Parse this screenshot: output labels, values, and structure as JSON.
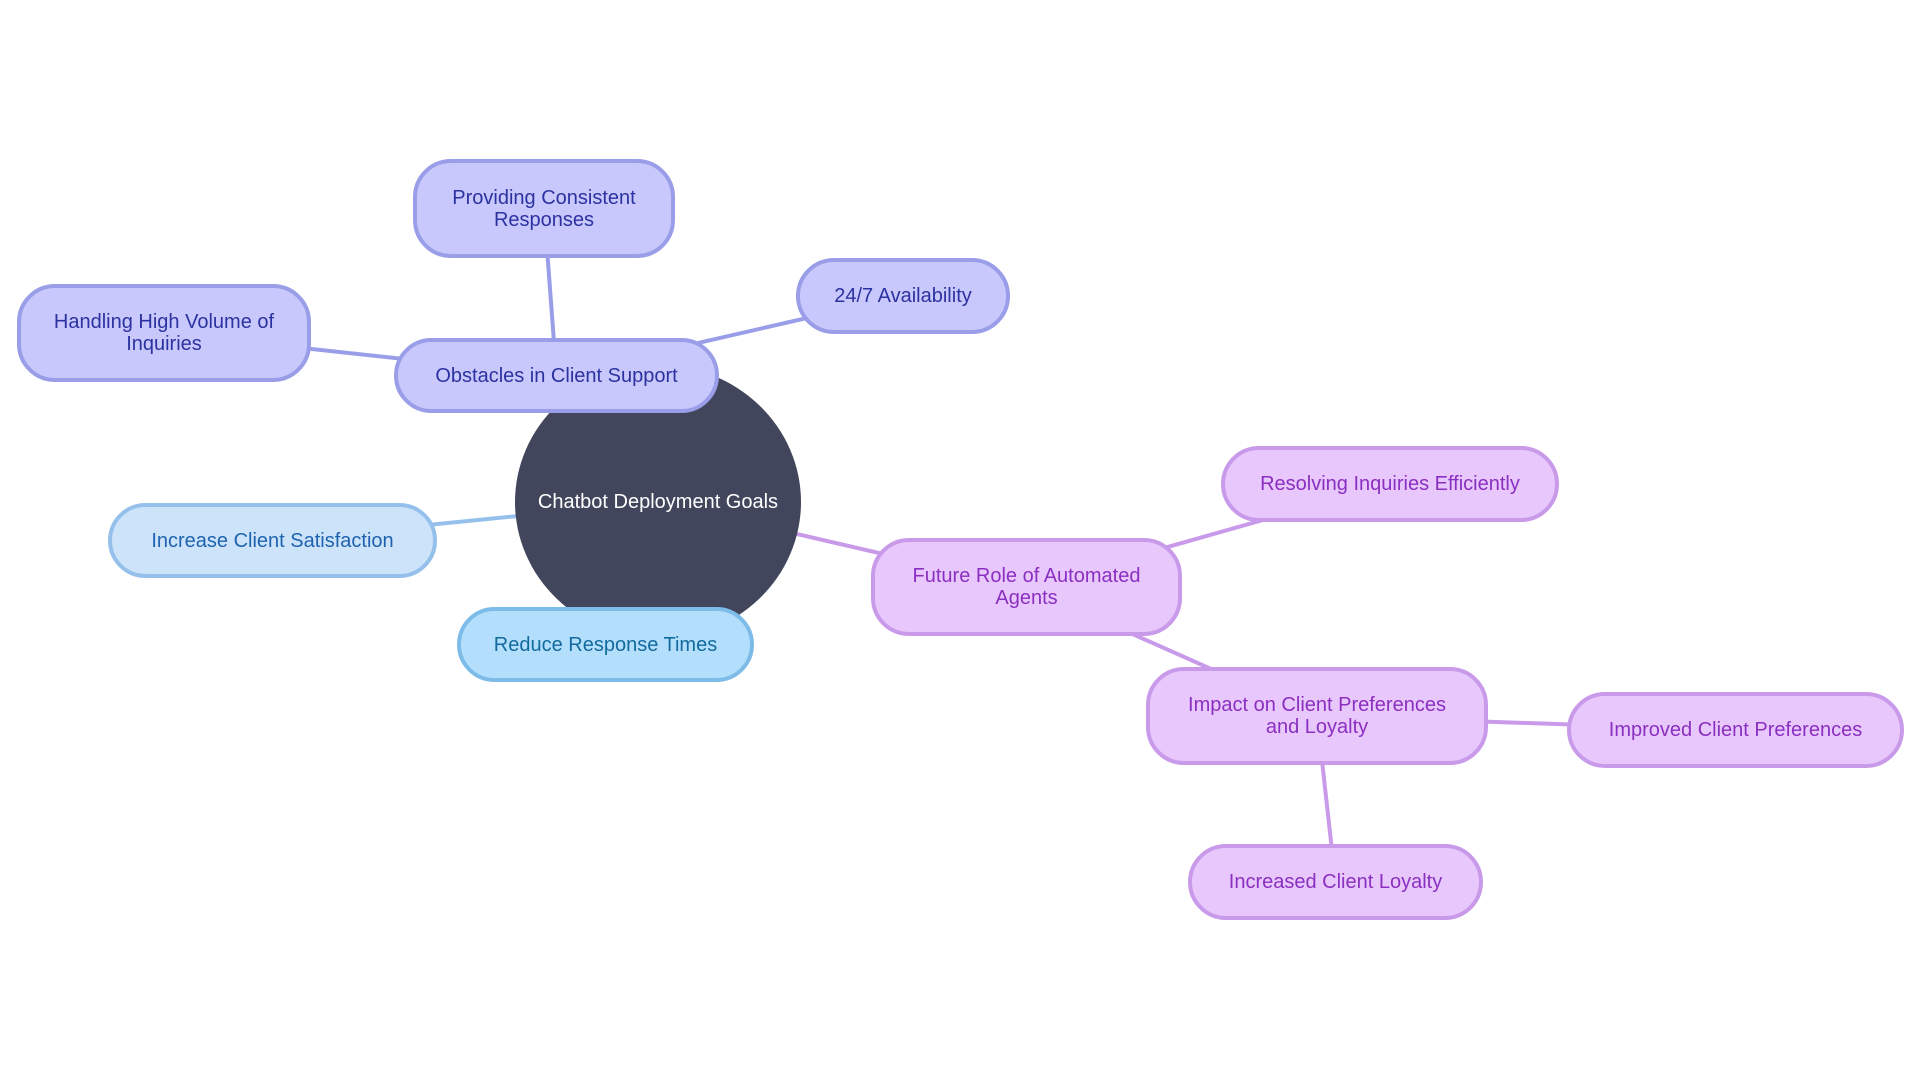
{
  "title": "Chatbot Deployment Goals",
  "colors": {
    "root_fill": "#42465c",
    "root_text": "#ffffff",
    "indigo": {
      "fill": "#c8c8fc",
      "stroke": "#9a9ee8",
      "text": "#2c32a0",
      "edge": "#9a9ee8"
    },
    "lightblue": {
      "fill": "#cce3fa",
      "stroke": "#95c0ec",
      "text": "#1f63b0",
      "edge": "#95c0ec"
    },
    "skyblue": {
      "fill": "#b3dffc",
      "stroke": "#7dbbe8",
      "text": "#136a9e",
      "edge": "#7dbbe8"
    },
    "purple": {
      "fill": "#e8c8fc",
      "stroke": "#c99aea",
      "text": "#8a2fc0",
      "edge": "#c99aea"
    }
  },
  "root": {
    "id": "root",
    "label": "Chatbot Deployment Goals"
  },
  "nodes": [
    {
      "id": "obstacles",
      "label": "Obstacles in Client Support",
      "parent": "root",
      "theme": "indigo"
    },
    {
      "id": "consistent",
      "label": "Providing Consistent Responses",
      "lines": [
        "Providing Consistent",
        "Responses"
      ],
      "parent": "obstacles",
      "theme": "indigo"
    },
    {
      "id": "volume",
      "label": "Handling High Volume of Inquiries",
      "lines": [
        "Handling High Volume of",
        "Inquiries"
      ],
      "parent": "obstacles",
      "theme": "indigo"
    },
    {
      "id": "availability",
      "label": "24/7 Availability",
      "parent": "obstacles",
      "theme": "indigo"
    },
    {
      "id": "satisfaction",
      "label": "Increase Client Satisfaction",
      "parent": "root",
      "theme": "lightblue"
    },
    {
      "id": "response",
      "label": "Reduce Response Times",
      "parent": "root",
      "theme": "skyblue"
    },
    {
      "id": "future",
      "label": "Future Role of Automated Agents",
      "lines": [
        "Future Role of Automated",
        "Agents"
      ],
      "parent": "root",
      "theme": "purple"
    },
    {
      "id": "resolving",
      "label": "Resolving Inquiries Efficiently",
      "parent": "future",
      "theme": "purple"
    },
    {
      "id": "impact",
      "label": "Impact on Client Preferences and Loyalty",
      "lines": [
        "Impact on Client Preferences",
        "and Loyalty"
      ],
      "parent": "future",
      "theme": "purple"
    },
    {
      "id": "improved",
      "label": "Improved Client Preferences",
      "parent": "impact",
      "theme": "purple"
    },
    {
      "id": "loyalty",
      "label": "Increased Client Loyalty",
      "parent": "impact",
      "theme": "purple"
    }
  ]
}
